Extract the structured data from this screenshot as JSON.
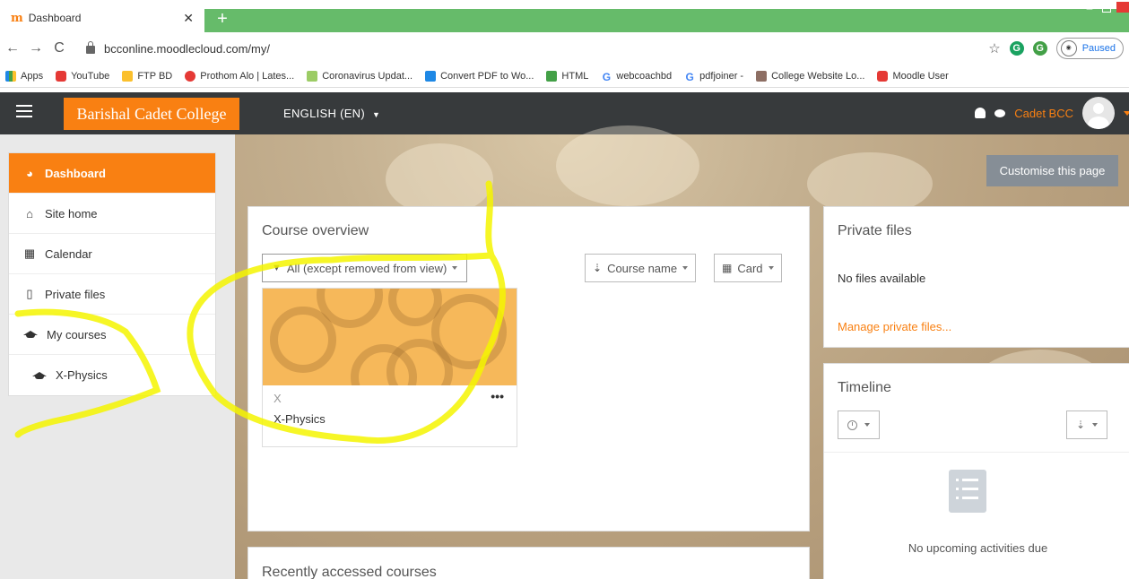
{
  "browser": {
    "tab_title": "Dashboard",
    "tab_favicon": "m",
    "url": "bcconline.moodlecloud.com/my/",
    "profile_status": "Paused",
    "bookmarks": [
      {
        "label": "Apps",
        "icon": "apps-icon"
      },
      {
        "label": "YouTube",
        "icon": "youtube-icon"
      },
      {
        "label": "FTP BD",
        "icon": "folder-icon"
      },
      {
        "label": "Prothom Alo | Lates...",
        "icon": "prothom-alo-icon"
      },
      {
        "label": "Coronavirus Updat...",
        "icon": "coronavirus-icon"
      },
      {
        "label": "Convert PDF to Wo...",
        "icon": "pdf-icon"
      },
      {
        "label": "HTML",
        "icon": "html-icon"
      },
      {
        "label": "webcoachbd",
        "icon": "google-icon"
      },
      {
        "label": "pdfjoiner -",
        "icon": "google-icon"
      },
      {
        "label": "College Website Lo...",
        "icon": "college-icon"
      },
      {
        "label": "Moodle User",
        "icon": "youtube-icon"
      }
    ]
  },
  "navbar": {
    "site_name": "Barishal Cadet College",
    "language": "ENGLISH (EN)",
    "user_name": "Cadet BCC"
  },
  "drawer": {
    "items": [
      {
        "label": "Dashboard",
        "icon": "dashboard-icon",
        "active": true
      },
      {
        "label": "Site home",
        "icon": "home-icon"
      },
      {
        "label": "Calendar",
        "icon": "calendar-icon"
      },
      {
        "label": "Private files",
        "icon": "file-icon"
      },
      {
        "label": "My courses",
        "icon": "graduation-cap-icon"
      },
      {
        "label": "X-Physics",
        "icon": "graduation-cap-icon"
      }
    ]
  },
  "customise_button": "Customise this page",
  "course_overview": {
    "title": "Course overview",
    "filter": "All (except removed from view)",
    "sort": "Course name",
    "view": "Card",
    "courses": [
      {
        "category": "X",
        "name": "X-Physics"
      }
    ]
  },
  "private_files": {
    "title": "Private files",
    "empty_text": "No files available",
    "manage_link": "Manage private files..."
  },
  "timeline": {
    "title": "Timeline",
    "empty_text": "No upcoming activities due"
  },
  "recently_accessed": {
    "title": "Recently accessed courses"
  },
  "colors": {
    "brand": "#f98012",
    "navbar": "#373a3c",
    "highlight": "#f5f500"
  }
}
